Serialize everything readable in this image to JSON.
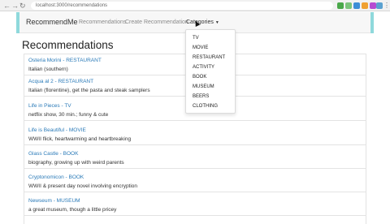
{
  "browser": {
    "url": "localhost:3000/recommendations",
    "ext_colors": [
      "#4aa84a",
      "#7bc47b",
      "#3c8dd6",
      "#f0a030",
      "#b64bd1",
      "#5aa1d0",
      "#9b9b9b"
    ]
  },
  "navbar": {
    "brand": "RecommendMe",
    "links": {
      "recommendations": "Recommendations",
      "create": "Create Recommendation",
      "categories": "Categories"
    }
  },
  "page": {
    "title": "Recommendations"
  },
  "recommendations": [
    {
      "title": "Osteria Morini - RESTAURANT",
      "desc": "Italian (southern)"
    },
    {
      "title": "Acqua al 2 - RESTAURANT",
      "desc": "Italian (florentine), get the pasta and steak samplers"
    },
    {
      "title": "Life in Pieces - TV",
      "desc": "netflix show, 30 min.; funny & cute"
    },
    {
      "title": "Life is Beautiful - MOVIE",
      "desc": "WWII flick, heartwarming and heartbreaking"
    },
    {
      "title": "Glass Castle - BOOK",
      "desc": "biography, growing up with weird parents"
    },
    {
      "title": "Cryptonomicon - BOOK",
      "desc": "WWII & present day novel involving encryption"
    },
    {
      "title": "Newseum - MUSEUM",
      "desc": "a great museum, though a little pricey"
    }
  ],
  "categories": {
    "items": [
      "TV",
      "MOVIE",
      "RESTAURANT",
      "ACTIVITY",
      "BOOK",
      "MUSEUM",
      "BEERS",
      "CLOTHING"
    ]
  }
}
